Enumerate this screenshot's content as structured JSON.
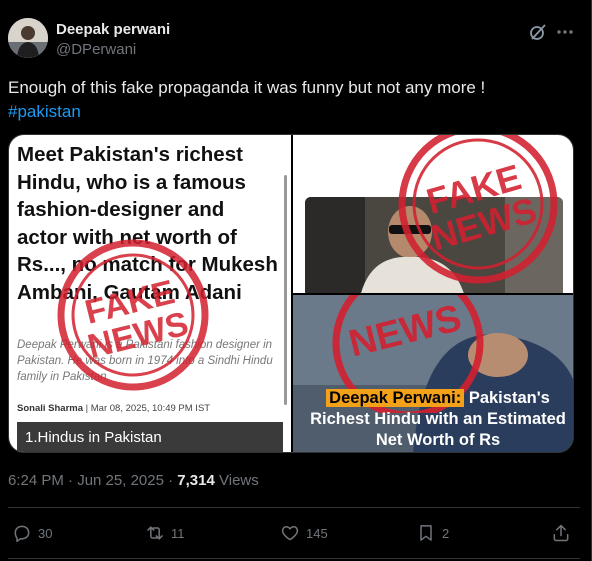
{
  "author": {
    "name": "Deepak perwani",
    "handle": "@DPerwani"
  },
  "post": {
    "text": "Enough of this fake propaganda it was funny but not any more !",
    "hashtag": "#pakistan"
  },
  "media": {
    "left": {
      "headline": "Meet Pakistan's richest Hindu, who is a famous fashion-designer and actor with net worth of Rs..., no match for Mukesh Ambani, Gautam Adani",
      "subtext": "Deepak Perwani is a Pakistani fashion designer in Pakistan. He was born in 1974 into a Sindhi Hindu family in Pakistan.",
      "byline_author": "Sonali Sharma",
      "byline_date": "Mar 08, 2025, 10:49 PM IST",
      "box_text": "1.Hindus in Pakistan"
    },
    "stamp": {
      "word1": "FAKE",
      "word2": "NEWS"
    },
    "right_bottom": {
      "caption_highlight": "Deepak Perwani:",
      "caption_rest": "Pakistan's Richest Hindu with an Estimated Net Worth of Rs"
    }
  },
  "meta": {
    "time": "6:24 PM · Jun 25, 2025 ·",
    "views_count": "7,314",
    "views_label": "Views"
  },
  "actions": {
    "replies": "30",
    "reposts": "11",
    "likes": "145",
    "bookmarks": "2"
  },
  "colors": {
    "background": "#000000",
    "text": "#e7e9ea",
    "muted": "#71767b",
    "link": "#1d9bf0",
    "stamp_red": "#d3202f",
    "highlight": "#f4a11a"
  }
}
